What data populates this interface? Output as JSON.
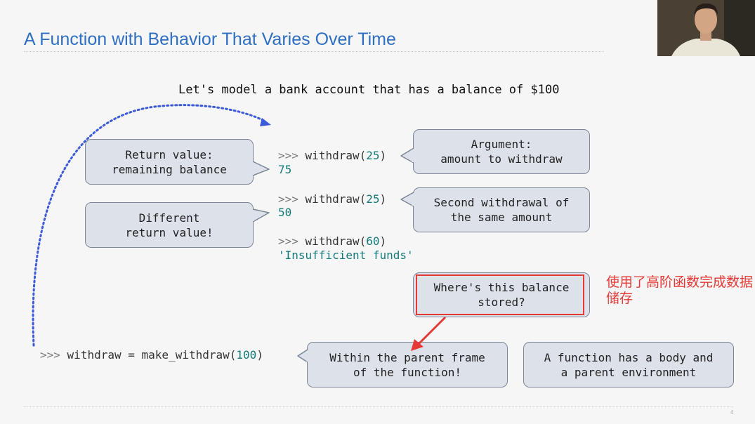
{
  "slide": {
    "title": "A Function with Behavior That Varies Over Time",
    "intro": "Let's model a bank account that has a balance of $100",
    "page_number": "4"
  },
  "code": {
    "prompt": ">>>",
    "call_name": "withdraw",
    "calls": [
      {
        "arg": "25",
        "result": "75"
      },
      {
        "arg": "25",
        "result": "50"
      },
      {
        "arg": "60",
        "result": "'Insufficient funds'"
      }
    ],
    "assign_lhs": "withdraw",
    "assign_op": "=",
    "assign_fn": "make_withdraw",
    "assign_arg": "100"
  },
  "bubbles": {
    "return_value": "Return value:\nremaining balance",
    "argument": "Argument:\namount to withdraw",
    "different": "Different\nreturn value!",
    "second_withdrawal": "Second withdrawal of\nthe same amount",
    "where_stored": "Where's this balance\nstored?",
    "parent_frame": "Within the parent frame\nof the function!",
    "function_body": "A function has a body and\na parent environment"
  },
  "annotation": {
    "text": "使用了高阶函数完成数据储存",
    "color": "#e53935"
  },
  "colors": {
    "title": "#2f6fc3",
    "dotted_arrow": "#3b5bdb",
    "bubble_fill": "#dde2ea",
    "code_literal": "#147a7a"
  }
}
